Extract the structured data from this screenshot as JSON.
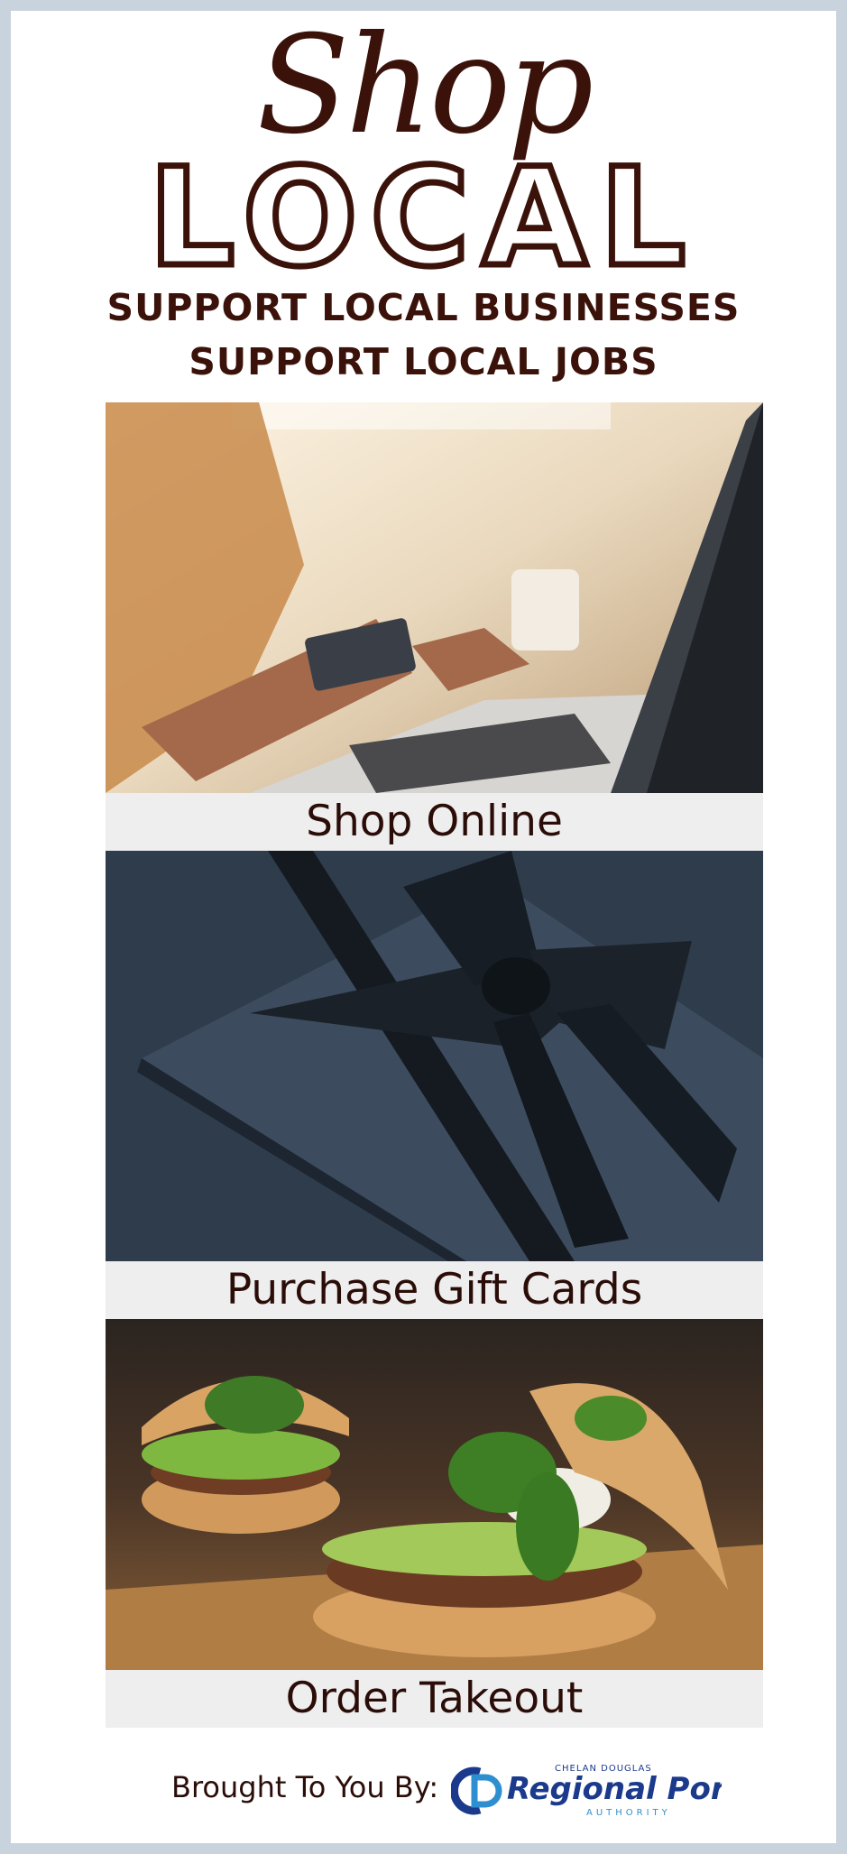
{
  "header": {
    "script_title": "Shop",
    "outline_title": "LOCAL",
    "tagline_1": "SUPPORT LOCAL BUSINESSES",
    "tagline_2": "SUPPORT LOCAL JOBS"
  },
  "sections": [
    {
      "caption": "Shop Online"
    },
    {
      "caption": "Purchase Gift Cards"
    },
    {
      "caption": "Order Takeout"
    }
  ],
  "footer": {
    "brought_by": "Brought To You By:",
    "logo_small_top": "CHELAN DOUGLAS",
    "logo_main": "Regional Port",
    "logo_small_bottom": "AUTHORITY"
  },
  "colors": {
    "brand_brown": "#3a120a",
    "logo_blue": "#1b3a8c"
  }
}
